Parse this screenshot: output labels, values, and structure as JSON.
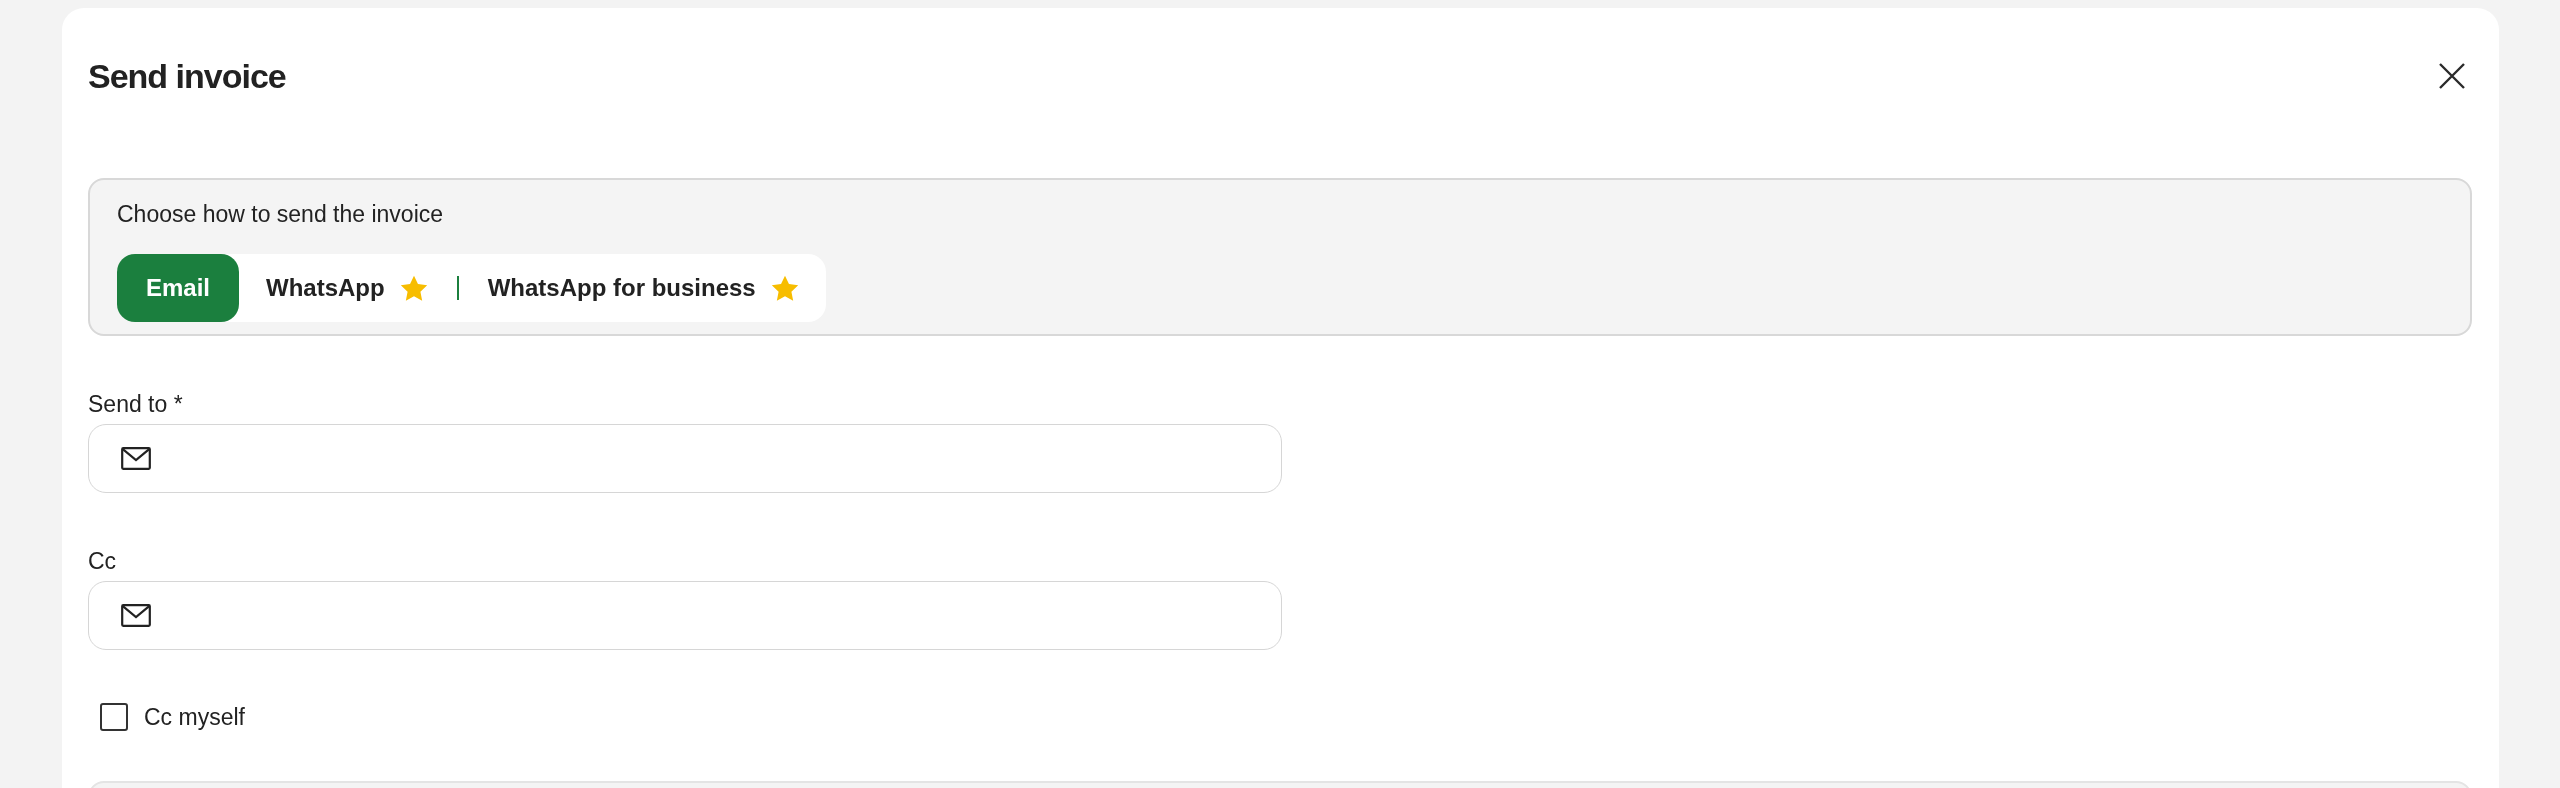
{
  "dialog": {
    "title": "Send invoice"
  },
  "delivery": {
    "prompt": "Choose how to send the invoice",
    "methods": [
      {
        "label": "Email",
        "selected": true,
        "premium": false
      },
      {
        "label": "WhatsApp",
        "selected": false,
        "premium": true
      },
      {
        "label": "WhatsApp for business",
        "selected": false,
        "premium": true
      }
    ]
  },
  "fields": [
    {
      "label": "Send to *"
    },
    {
      "label": "Cc"
    }
  ],
  "cc_myself": {
    "label": "Cc myself",
    "checked": false
  }
}
